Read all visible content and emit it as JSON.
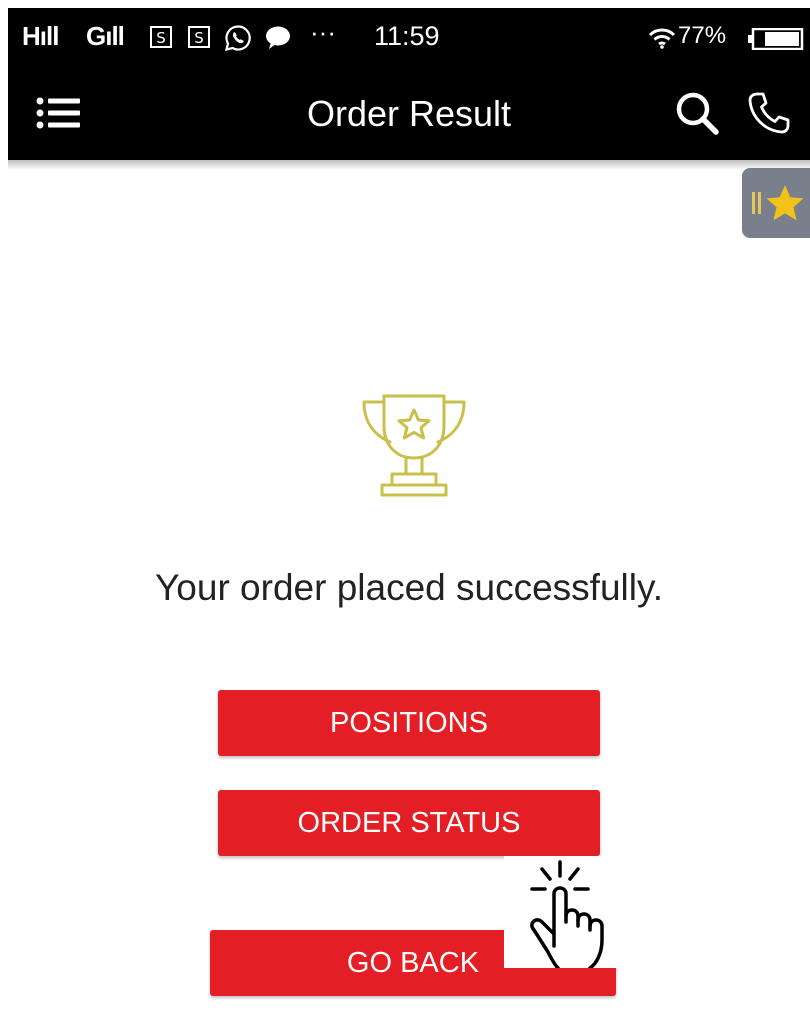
{
  "status_bar": {
    "signal_1": "Hıll",
    "signal_2": "Gıll",
    "notification_icons": [
      "sim-s-icon",
      "sim-s-icon",
      "whatsapp-icon",
      "chat-bubble-icon"
    ],
    "more": "···",
    "time": "11:59",
    "battery": "77%"
  },
  "app_bar": {
    "title": "Order Result",
    "menu_icon": "menu-icon",
    "search_icon": "search-icon",
    "call_icon": "phone-icon"
  },
  "favorite_tab": {
    "icon": "star-icon"
  },
  "result": {
    "icon": "trophy-icon",
    "message": "Your order placed successfully."
  },
  "actions": {
    "positions_label": "POSITIONS",
    "order_status_label": "ORDER STATUS",
    "go_back_label": "GO BACK"
  },
  "overlay": {
    "icon": "tap-hand-icon"
  },
  "colors": {
    "primary_button": "#e31e24",
    "app_bar": "#000000",
    "trophy": "#c8c04a",
    "favorite_tab": "#79808c",
    "star": "#f2c21b"
  }
}
